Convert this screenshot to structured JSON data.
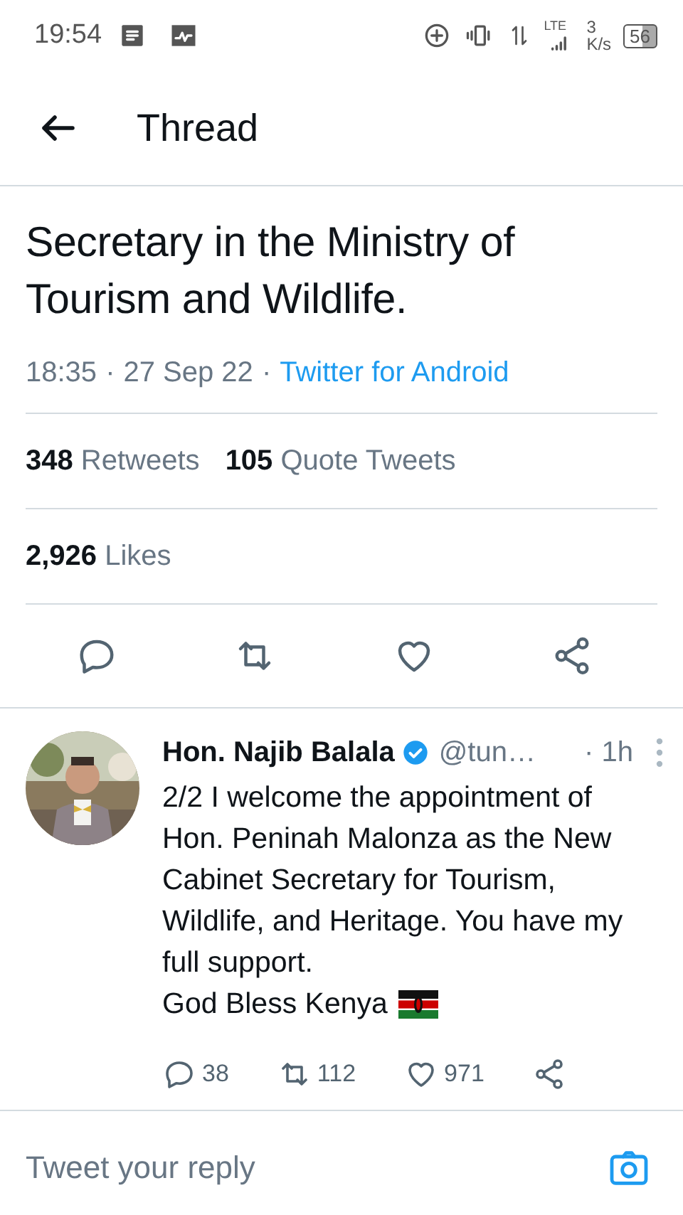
{
  "status_bar": {
    "time": "19:54",
    "network_type": "LTE",
    "speed_value": "3",
    "speed_unit": "K/s",
    "battery": "56"
  },
  "header": {
    "title": "Thread"
  },
  "tweet": {
    "text_lines": [
      "Secretary in the Ministry of",
      "Tourism and Wildlife."
    ],
    "time": "18:35",
    "separator": "·",
    "date": "27 Sep 22",
    "separator_2": "·",
    "source": "Twitter for Android",
    "stats": [
      {
        "count": "348",
        "label": "Retweets"
      },
      {
        "count": "105",
        "label": "Quote Tweets"
      }
    ],
    "likes": {
      "count": "2,926",
      "label": "Likes"
    }
  },
  "reply": {
    "kind": "picture",
    "name": "Hon. Najib Balala",
    "verified": true,
    "handle": "@tun…",
    "age": "· 1h",
    "text": "2/2 I welcome the appointment of Hon. Peninah Malonza as the New Cabinet Secretary for Tourism, Wildlife, and Heritage. You have my full support.",
    "last_line": "God Bless Kenya",
    "replies": "38",
    "retweets": "112",
    "likes": "971"
  },
  "composer": {
    "placeholder": "Tweet your reply"
  }
}
